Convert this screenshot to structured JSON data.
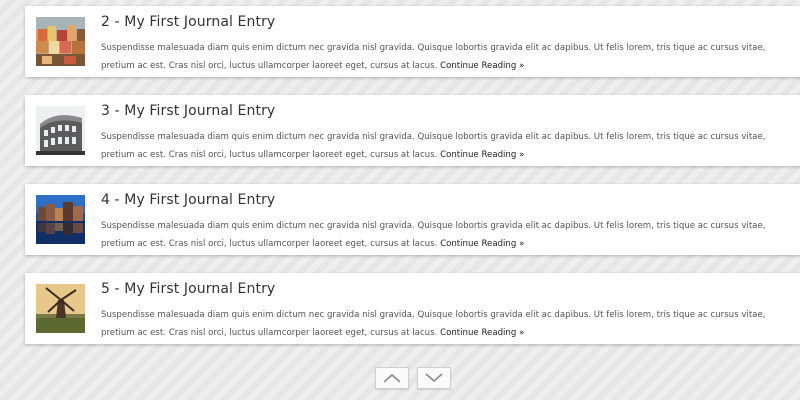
{
  "entries": [
    {
      "title": "2 - My First Journal Entry",
      "thumb_icon": "village-photo-icon",
      "excerpt": "Suspendisse malesuada diam quis enim dictum nec gravida nisl gravida. Quisque lobortis gravida elit ac dapibus. Ut felis lorem, tris tique ac cursus vitae, pretium ac est. Cras nisl orci, luctus ullamcorper laoreet eget, cursus at lacus.",
      "more": "Continue Reading »"
    },
    {
      "title": "3 - My First Journal Entry",
      "thumb_icon": "colosseum-photo-icon",
      "excerpt": "Suspendisse malesuada diam quis enim dictum nec gravida nisl gravida. Quisque lobortis gravida elit ac dapibus. Ut felis lorem, tris tique ac cursus vitae, pretium ac est. Cras nisl orci, luctus ullamcorper laoreet eget, cursus at lacus.",
      "more": "Continue Reading »"
    },
    {
      "title": "4 - My First Journal Entry",
      "thumb_icon": "canal-houses-photo-icon",
      "excerpt": "Suspendisse malesuada diam quis enim dictum nec gravida nisl gravida. Quisque lobortis gravida elit ac dapibus. Ut felis lorem, tris tique ac cursus vitae, pretium ac est. Cras nisl orci, luctus ullamcorper laoreet eget, cursus at lacus.",
      "more": "Continue Reading »"
    },
    {
      "title": "5 - My First Journal Entry",
      "thumb_icon": "windmill-photo-icon",
      "excerpt": "Suspendisse malesuada diam quis enim dictum nec gravida nisl gravida. Quisque lobortis gravida elit ac dapibus. Ut felis lorem, tris tique ac cursus vitae, pretium ac est. Cras nisl orci, luctus ullamcorper laoreet eget, cursus at lacus.",
      "more": "Continue Reading »"
    }
  ],
  "pager": {
    "up_icon": "chevron-up-icon",
    "down_icon": "chevron-down-icon"
  },
  "colors": {
    "card": "#ffffff",
    "text": "#555555",
    "title": "#333333",
    "background": "#ececec"
  }
}
